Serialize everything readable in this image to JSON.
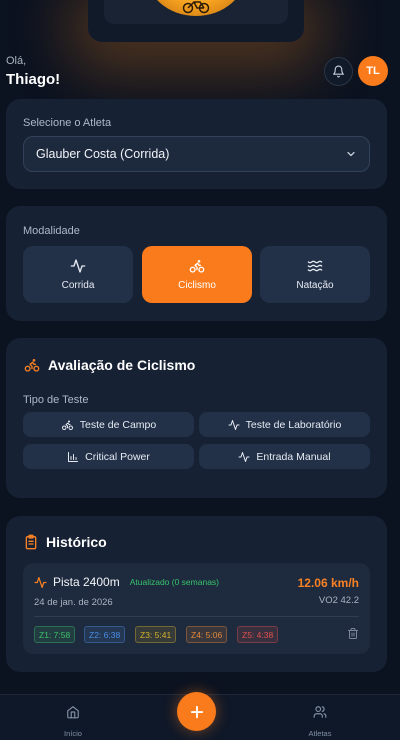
{
  "header": {
    "greeting": "Olá,",
    "user_name": "Thiago!",
    "avatar_initials": "TL"
  },
  "athlete_select": {
    "label": "Selecione o Atleta",
    "selected": "Glauber Costa (Corrida)"
  },
  "modality": {
    "label": "Modalidade",
    "options": [
      {
        "label": "Corrida",
        "icon": "activity-icon",
        "active": false
      },
      {
        "label": "Ciclismo",
        "icon": "bike-icon",
        "active": true
      },
      {
        "label": "Natação",
        "icon": "waves-icon",
        "active": false
      }
    ]
  },
  "evaluation": {
    "title": "Avaliação de Ciclismo",
    "test_type_label": "Tipo de Teste",
    "tests": [
      {
        "label": "Teste de Campo",
        "icon": "bike-icon"
      },
      {
        "label": "Teste de Laboratório",
        "icon": "activity-icon"
      },
      {
        "label": "Critical Power",
        "icon": "bar-chart-icon"
      },
      {
        "label": "Entrada Manual",
        "icon": "activity-icon"
      }
    ]
  },
  "history": {
    "title": "Histórico",
    "items": [
      {
        "name": "Pista 2400m",
        "status": "Atualizado (0 semanas)",
        "date": "24 de jan. de 2026",
        "speed": "12.06 km/h",
        "vo2": "VO2 42.2",
        "zones": [
          {
            "label": "Z1: 7:58",
            "color": "#3fbf6a"
          },
          {
            "label": "Z2: 6:38",
            "color": "#4a8fe7"
          },
          {
            "label": "Z3: 5:41",
            "color": "#d4b02c"
          },
          {
            "label": "Z4: 5:06",
            "color": "#e58a3a"
          },
          {
            "label": "Z5: 4:38",
            "color": "#e0524f"
          }
        ]
      }
    ]
  },
  "tabbar": {
    "home_label": "Início",
    "athletes_label": "Atletas"
  },
  "colors": {
    "accent": "#f97b1c",
    "background": "#0b1220",
    "card": "#162133"
  }
}
